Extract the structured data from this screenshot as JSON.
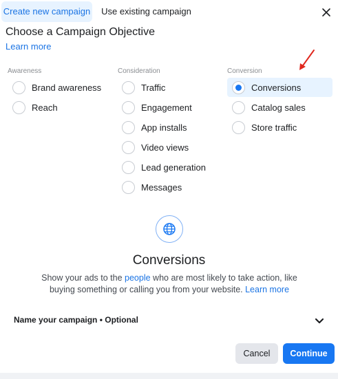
{
  "tabs": {
    "create_label": "Create new campaign",
    "existing_label": "Use existing campaign"
  },
  "header": {
    "title": "Choose a Campaign Objective",
    "learn_more": "Learn more"
  },
  "columns": [
    {
      "category": "Awareness",
      "options": [
        "Brand awareness",
        "Reach"
      ]
    },
    {
      "category": "Consideration",
      "options": [
        "Traffic",
        "Engagement",
        "App installs",
        "Video views",
        "Lead generation",
        "Messages"
      ]
    },
    {
      "category": "Conversion",
      "options": [
        "Conversions",
        "Catalog sales",
        "Store traffic"
      ]
    }
  ],
  "selected_option": "Conversions",
  "detail": {
    "icon": "globe-icon",
    "title": "Conversions",
    "desc_part1": "Show your ads to the ",
    "desc_link1": "people",
    "desc_part2": " who are most likely to take action, like buying something or calling you from your website. ",
    "desc_link2": "Learn more"
  },
  "name_section": {
    "label": "Name your campaign • Optional"
  },
  "footer": {
    "cancel_label": "Cancel",
    "continue_label": "Continue"
  },
  "colors": {
    "accent": "#1877f2",
    "arrow": "#e0281e"
  }
}
